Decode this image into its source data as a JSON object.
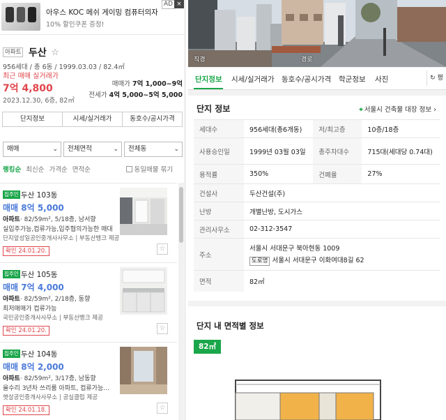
{
  "ad": {
    "title": "아우스 KOC 메쉬 게이밍 컴퓨터의자",
    "subtitle": "10% 할인쿠폰 증정!",
    "badge": "AD",
    "close": "×"
  },
  "complex": {
    "type_tag": "아파트",
    "name": "두산",
    "info": "956세대 / 총 6동 / 1999.03.03 / 82.4㎡",
    "recent_label": "최근 매매 실거래가",
    "recent_price": "7억 4,800",
    "recent_date": "2023.12.30, 6층, 82㎡",
    "sale_label": "매매가",
    "sale_value": "7억 1,000~9억",
    "jeonse_label": "전세가",
    "jeonse_value": "4억 5,000~5억 5,000"
  },
  "buttons": [
    "단지정보",
    "시세/실거래가",
    "동호수/공시가격"
  ],
  "filters": [
    "매매",
    "전체면적",
    "전체동"
  ],
  "sort": {
    "options": [
      "랭킹순",
      "최신순",
      "가격순",
      "면적순"
    ],
    "active_index": 0,
    "checkbox_label": "동일매물 묶기"
  },
  "listings": [
    {
      "badge": "집주인",
      "title": "두산 103동",
      "price": "매매 8억 5,000",
      "spec_type": "아파트",
      "spec": "· 82/59m², 5/18층, 남서향",
      "desc": "실입주가능,컵류가능,입주협의가능한 매대",
      "agent": "단지앞성일공인중개사사무소 | 부동산뱅크 제공",
      "confirm": "확인 24.01.20."
    },
    {
      "badge": "집주인",
      "title": "두산 105동",
      "price": "매매 7억 4,000",
      "spec_type": "아파트",
      "spec": "· 82/59m², 2/18층, 동향",
      "desc": "최저매매가 컵류가능",
      "agent": "국민공인중개사사무소 | 부동산뱅크 제공",
      "confirm": "확인 24.01.20."
    },
    {
      "badge": "집주인",
      "title": "두산 104동",
      "price": "매매 8억 2,000",
      "spec_type": "아파트",
      "spec": "· 82/59m², 3/17층, 남동향",
      "desc": "올수리 3년차 쓰리룸 아파트, 컵류가능...",
      "agent": "햇살공인중개사사무소 | 공실클럽 제공",
      "confirm": "확인 24.01.18."
    }
  ],
  "street": {
    "label_left": "직경",
    "label_right": "경로"
  },
  "tabs": {
    "items": [
      "단지정보",
      "시세/실거래가",
      "동호수/공시가격",
      "학군정보",
      "사진"
    ],
    "active_index": 0,
    "toggle": "평"
  },
  "complex_info": {
    "title": "단지 정보",
    "link": "서울시 건축물 대장 정보",
    "households_label": "세대수",
    "households": "956세대(총6개동)",
    "floors_label": "저/최고층",
    "floors": "10층/18층",
    "approval_label": "사용승인일",
    "approval": "1999년 03월 03일",
    "parking_label": "총주차대수",
    "parking": "715대(세대당 0.74대)",
    "far_label": "용적률",
    "far": "350%",
    "bcr_label": "건폐율",
    "bcr": "27%",
    "builder_label": "건설사",
    "builder": "두산건설(주)",
    "heating_label": "난방",
    "heating": "개별난방, 도시가스",
    "office_label": "관리사무소",
    "office": "02-312-3547",
    "address_label": "주소",
    "address": "서울시 서대문구 북아현동 1009",
    "road_badge": "도로명",
    "road_address": "서울시 서대문구 이화여대8길 62",
    "area_label": "면적",
    "area": "82㎡"
  },
  "area_section": {
    "title": "단지 내 면적별 정보",
    "chip": "82㎡"
  },
  "colors": {
    "accent_green": "#1aa64a",
    "price_red": "#e0454b",
    "price_blue": "#4a79d9"
  }
}
